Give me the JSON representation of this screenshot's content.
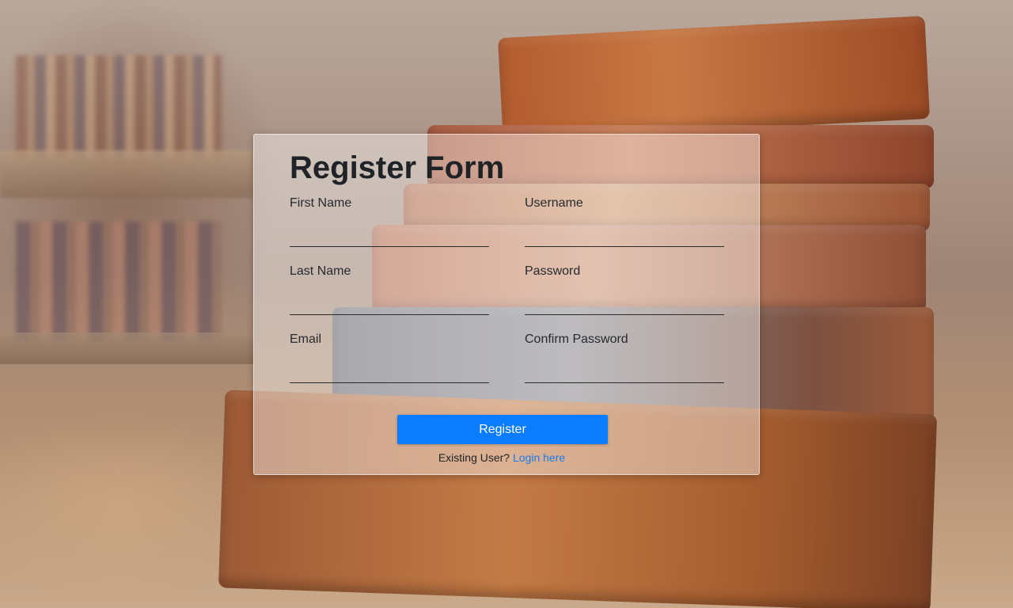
{
  "form": {
    "title": "Register Form",
    "fields": {
      "first_name": {
        "label": "First Name",
        "value": ""
      },
      "username": {
        "label": "Username",
        "value": ""
      },
      "last_name": {
        "label": "Last Name",
        "value": ""
      },
      "password": {
        "label": "Password",
        "value": ""
      },
      "email": {
        "label": "Email",
        "value": ""
      },
      "confirm_password": {
        "label": "Confirm Password",
        "value": ""
      }
    },
    "register_label": "Register",
    "existing_user_text": "Existing User?",
    "login_link_label": "Login here"
  },
  "colors": {
    "button": "#0a7cff",
    "link": "#1a7ae8",
    "panel": "rgba(255,255,255,0.42)"
  }
}
